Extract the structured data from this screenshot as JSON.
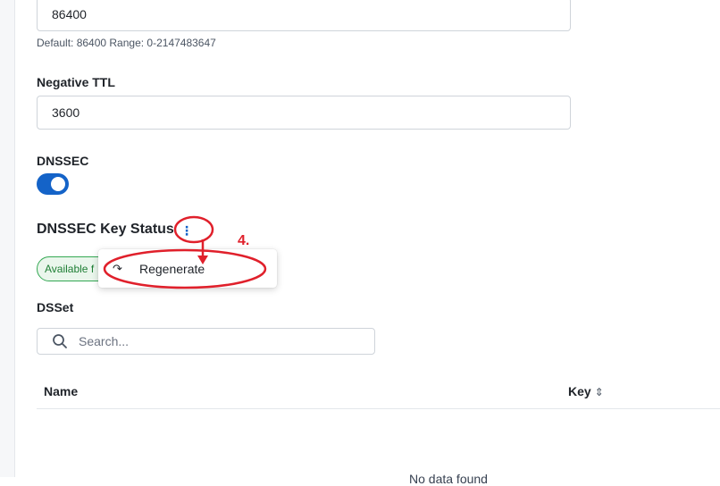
{
  "ttl": {
    "value": "86400",
    "hint": "Default: 86400 Range: 0-2147483647"
  },
  "negative_ttl": {
    "label": "Negative TTL",
    "value": "3600"
  },
  "dnssec": {
    "label": "DNSSEC",
    "enabled": true
  },
  "key_status": {
    "title": "DNSSEC Key Status",
    "badge": "Available f",
    "menu": {
      "icon": "redo-icon",
      "item_label": "Regenerate"
    }
  },
  "dsset": {
    "label": "DSSet",
    "search_placeholder": "Search...",
    "columns": [
      "Name",
      "Key"
    ],
    "empty_text": "No data found"
  },
  "annotation": {
    "step_label": "4.",
    "color": "#e0202b"
  },
  "colors": {
    "accent": "#1463c8",
    "success": "#34a853"
  }
}
